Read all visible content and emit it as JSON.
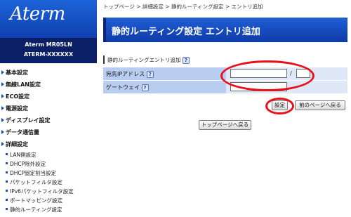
{
  "sidebar": {
    "logo": "Aterm",
    "model_line1": "Aterm MR05LN",
    "model_line2": "ATERM-XXXXXX",
    "menu": [
      {
        "label": "基本設定"
      },
      {
        "label": "無線LAN設定"
      },
      {
        "label": "ECO設定"
      },
      {
        "label": "電源設定"
      },
      {
        "label": "ディスプレイ設定"
      },
      {
        "label": "データ通信量"
      },
      {
        "label": "詳細設定"
      }
    ],
    "submenu": [
      {
        "label": "LAN側設定"
      },
      {
        "label": "DHCP除外設定"
      },
      {
        "label": "DHCP固定割当設定"
      },
      {
        "label": "パケットフィルタ設定"
      },
      {
        "label": "IPv6パケットフィルタ設定"
      },
      {
        "label": "ポートマッピング設定"
      },
      {
        "label": "静的ルーティング設定"
      }
    ]
  },
  "breadcrumb": "トップページ > 詳細設定 > 静的ルーティング設定 > エントリ追加",
  "page_title": "静的ルーティング設定 エントリ追加",
  "section": {
    "label": "静的ルーティングエントリ追加",
    "help": "?"
  },
  "form": {
    "dest_label": "宛先IPアドレス",
    "dest_help": "?",
    "dest_value": "",
    "slash": "/",
    "mask_value": "",
    "gateway_label": "ゲートウェイ",
    "gateway_help": "?",
    "gateway_value": ""
  },
  "buttons": {
    "save": "設定",
    "back": "前のページへ戻る",
    "top": "トップページへ戻る"
  },
  "colors": {
    "brand_blue": "#1e5fd6",
    "annotation_red": "#e8101a"
  }
}
